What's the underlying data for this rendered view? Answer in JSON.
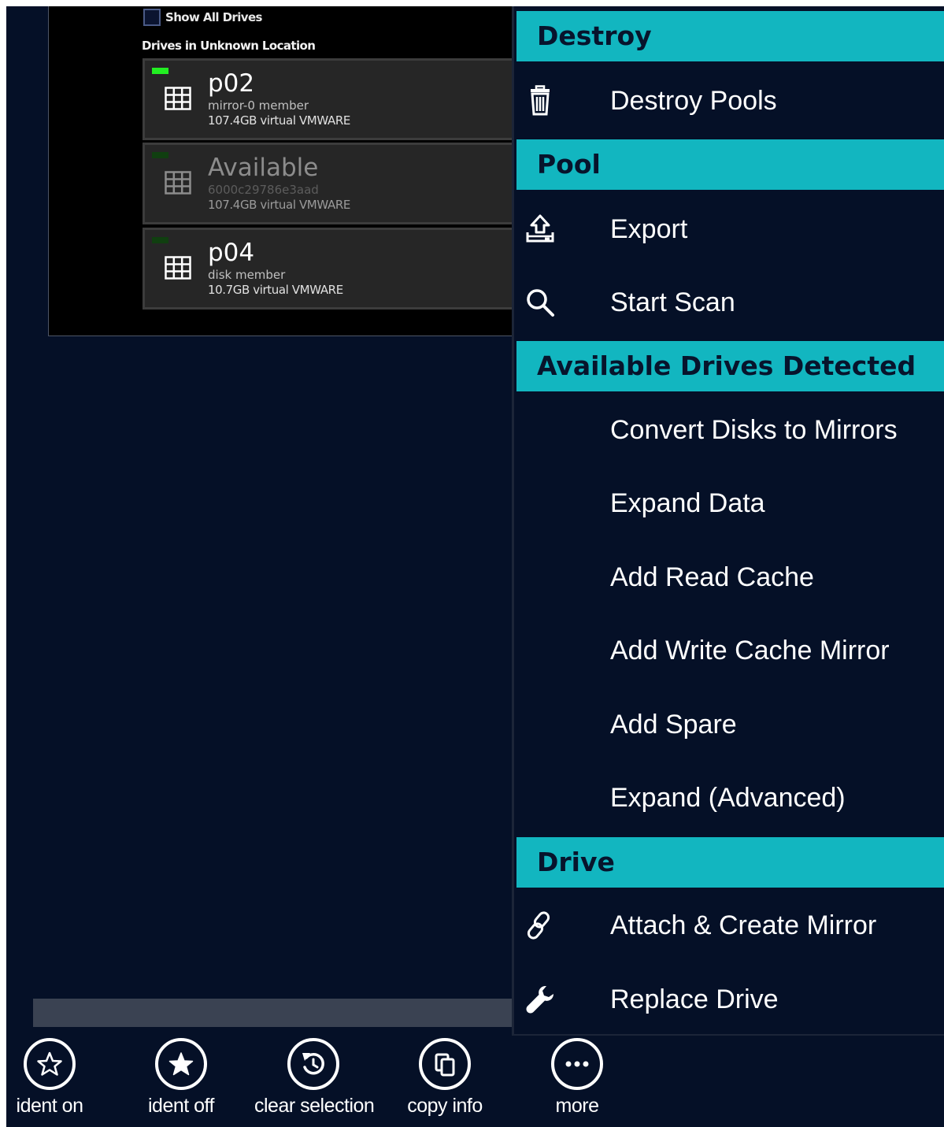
{
  "drive_panel": {
    "show_all_label": "Show All Drives",
    "section_label": "Drives in Unknown Location",
    "drives": [
      {
        "name": "p02",
        "subtitle": "mirror-0 member",
        "size": "107.4GB virtual VMWARE",
        "led": "on"
      },
      {
        "name": "Available",
        "subtitle": "6000c29786e3aad",
        "size": "107.4GB virtual VMWARE",
        "led": "off"
      },
      {
        "name": "p04",
        "subtitle": "disk member",
        "size": "10.7GB virtual VMWARE",
        "led": "off"
      }
    ]
  },
  "menu": {
    "destroy_header": "Destroy",
    "destroy_pools": "Destroy Pools",
    "pool_header": "Pool",
    "export": "Export",
    "start_scan": "Start Scan",
    "available_header": "Available Drives Detected",
    "convert_disks": "Convert Disks to Mirrors",
    "expand_data": "Expand Data",
    "add_read_cache": "Add Read Cache",
    "add_write_cache_mirror": "Add Write Cache Mirror",
    "add_spare": "Add Spare",
    "expand_advanced": "Expand (Advanced)",
    "drive_header": "Drive",
    "attach_create_mirror": "Attach & Create Mirror",
    "replace_drive": "Replace Drive"
  },
  "toolbar": {
    "ident_on": "ident on",
    "ident_off": "ident off",
    "clear_selection": "clear selection",
    "copy_info": "copy info",
    "more": "more"
  },
  "colors": {
    "background": "#051027",
    "menu_header": "#12b6c0",
    "led_active": "#22ee22"
  },
  "icons": [
    "grid-icon",
    "trash-icon",
    "export-icon",
    "search-icon",
    "link-icon",
    "wrench-icon",
    "star-outline-icon",
    "star-filled-icon",
    "undo-icon",
    "copy-icon",
    "ellipsis-icon"
  ]
}
